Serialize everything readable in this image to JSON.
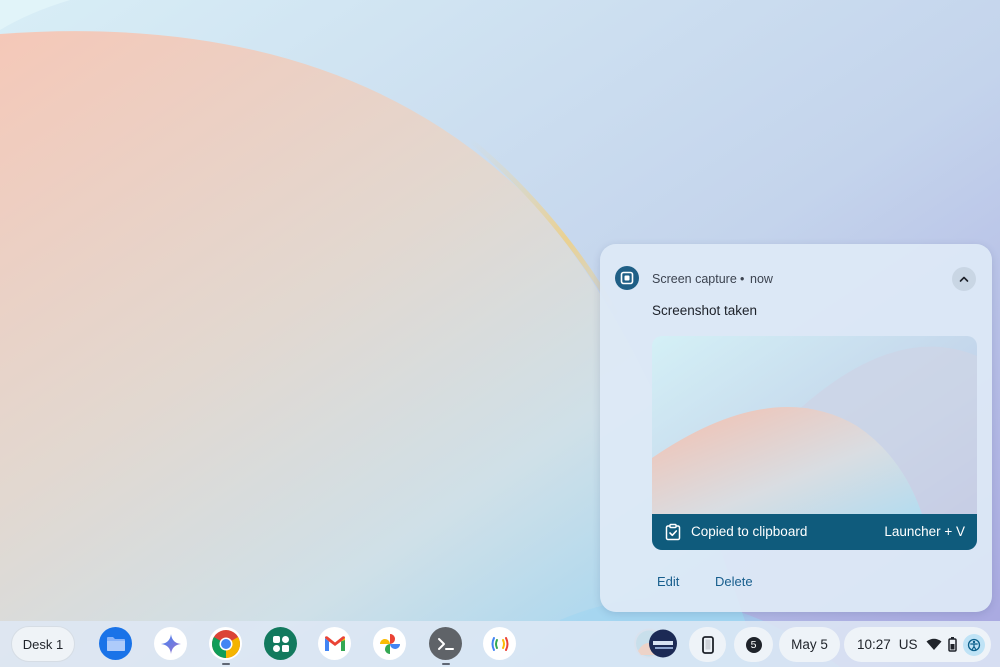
{
  "notification": {
    "app_name": "Screen capture",
    "separator": "•",
    "time": "now",
    "title": "Screenshot taken",
    "banner_text": "Copied to clipboard",
    "banner_shortcut": "Launcher + V",
    "actions": {
      "edit": "Edit",
      "delete": "Delete"
    }
  },
  "shelf": {
    "desk_label": "Desk 1",
    "apps": [
      {
        "name": "Files",
        "icon": "folder-icon"
      },
      {
        "name": "Gemini",
        "icon": "gemini-sparkle-icon"
      },
      {
        "name": "Chrome",
        "icon": "chrome-icon"
      },
      {
        "name": "Google Play Store apps",
        "icon": "apps-grid-icon"
      },
      {
        "name": "Gmail",
        "icon": "gmail-icon"
      },
      {
        "name": "Google Photos",
        "icon": "pinwheel-icon"
      },
      {
        "name": "Terminal",
        "icon": "terminal-icon"
      },
      {
        "name": "Web app",
        "icon": "rainbow-icon"
      }
    ],
    "notification_count": "5",
    "date": "May 5",
    "time": "10:27",
    "input_method": "US"
  },
  "colors": {
    "banner": "#0f5b7c",
    "action_text": "#175e8d",
    "app_icon": "#1f5f86"
  }
}
